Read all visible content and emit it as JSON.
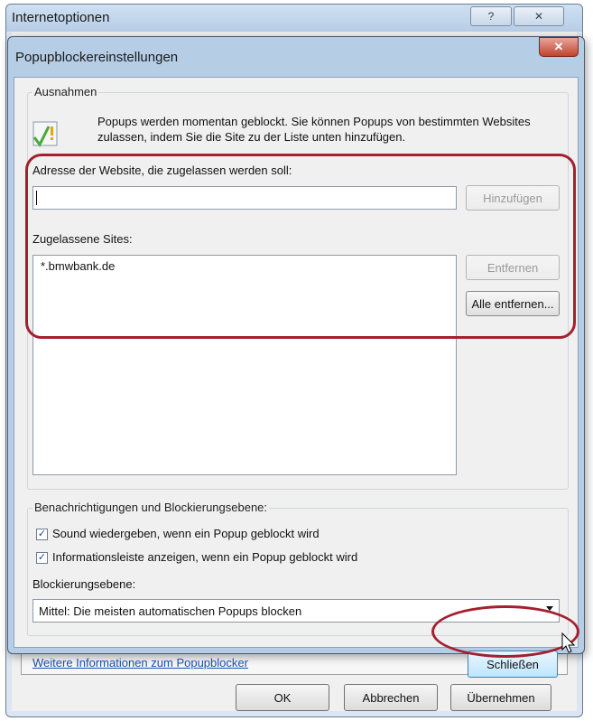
{
  "background_window": {
    "title": "Internetoptionen",
    "help_glyph": "?",
    "close_glyph": "✕",
    "buttons": {
      "ok": "OK",
      "cancel": "Abbrechen",
      "apply": "Übernehmen"
    }
  },
  "dialog": {
    "title": "Popupblockereinstellungen",
    "close_glyph": "✕",
    "exceptions": {
      "group_label": "Ausnahmen",
      "info_text": "Popups werden momentan geblockt. Sie können Popups von bestimmten Websites zulassen, indem Sie die Site zu der Liste unten hinzufügen.",
      "address_label": "Adresse der Website, die zugelassen werden soll:",
      "address_value": "",
      "add_button": "Hinzufügen",
      "allowed_label": "Zugelassene Sites:",
      "allowed_sites": [
        "*.bmwbank.de"
      ],
      "remove_button": "Entfernen",
      "remove_all_button": "Alle entfernen..."
    },
    "notifications": {
      "group_label": "Benachrichtigungen und Blockierungsebene:",
      "play_sound_label": "Sound wiedergeben, wenn ein Popup geblockt wird",
      "play_sound_checked": true,
      "show_infobar_label": "Informationsleiste anzeigen, wenn ein Popup geblockt wird",
      "show_infobar_checked": true,
      "blocking_level_label": "Blockierungsebene:",
      "blocking_level_value": "Mittel: Die meisten automatischen Popups blocken"
    },
    "more_info_link": "Weitere Informationen zum Popupblocker",
    "close_button": "Schließen"
  },
  "colors": {
    "annotation": "#a3202f",
    "link": "#1b4fb0",
    "close_button": "#c0432f"
  },
  "icons": [
    "warning-check-icon",
    "chevron-down-icon",
    "mouse-pointer-icon"
  ]
}
